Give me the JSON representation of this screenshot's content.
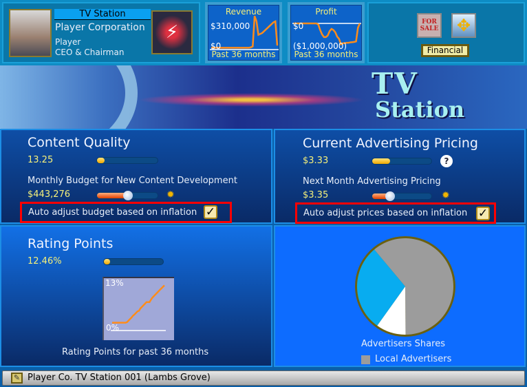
{
  "header": {
    "category": "TV Station",
    "company": "Player Corporation",
    "player": "Player",
    "role": "CEO & Chairman",
    "revenue": {
      "title": "Revenue",
      "top_label": "$310,000",
      "bottom_label": "$0",
      "period": "Past 36 months",
      "values": [
        5,
        5,
        5,
        5,
        5,
        5,
        5,
        5,
        5,
        5,
        5,
        5,
        5,
        5,
        5,
        5,
        5,
        5,
        5,
        5,
        5,
        10,
        20,
        360,
        300,
        150,
        160,
        170,
        190,
        210,
        230,
        250,
        270,
        290,
        300,
        30
      ]
    },
    "profit": {
      "title": "Profit",
      "top_label": "$0",
      "bottom_label": "($1,000,000)",
      "period": "Past 36 months",
      "values": [
        0,
        0,
        0,
        0,
        0,
        0,
        0,
        0,
        0,
        0,
        0,
        0,
        0,
        -50,
        -300,
        -500,
        -620,
        -620,
        -550,
        -350,
        -250,
        -300,
        -400,
        -600,
        -700,
        -950,
        -900,
        -900,
        -880,
        -880,
        -860,
        -850,
        -840,
        -820,
        -200,
        0
      ]
    },
    "for_sale_label": "FOR SALE",
    "financial_button": "Financial"
  },
  "banner": {
    "line1": "TV",
    "line2": "Station"
  },
  "content_quality": {
    "title": "Content Quality",
    "value": "13.25",
    "level": 0.13,
    "budget_label": "Monthly Budget for New Content Development",
    "budget_value": "$443,276",
    "budget_level": 0.5,
    "auto_label": "Auto adjust budget based on inflation",
    "auto_checked": true
  },
  "ad_pricing": {
    "title": "Current Advertising Pricing",
    "value": "$3.33",
    "level": 0.3,
    "help_label": "?",
    "next_label": "Next Month Advertising Pricing",
    "next_value": "$3.35",
    "next_level": 0.3,
    "auto_label": "Auto adjust prices based on inflation",
    "auto_checked": true
  },
  "rating": {
    "title": "Rating Points",
    "value": "12.46%",
    "level": 0.1,
    "top_label": "13%",
    "bottom_label": "0%",
    "caption": "Rating Points for past 36 months",
    "values": [
      0.3,
      0.3,
      0.3,
      0.3,
      0.3,
      0.3,
      0.3,
      0.3,
      0.3,
      0.3,
      0.5,
      1,
      1.5,
      2,
      2.6,
      3,
      3.5,
      4,
      4.2,
      5,
      5.5,
      6,
      6.5,
      7,
      7,
      7,
      7.8,
      8.5,
      9,
      9.5,
      10,
      10.5,
      11,
      11.5,
      12,
      12.46
    ]
  },
  "advertisers": {
    "caption": "Advertisers Shares",
    "legend": [
      {
        "label": "Local Advertisers",
        "color": "#9c9c9c"
      }
    ],
    "slices": [
      {
        "share": 61,
        "color": "#9c9c9c"
      },
      {
        "share": 10,
        "color": "#ffffff"
      },
      {
        "share": 29,
        "color": "#08acf0"
      }
    ]
  },
  "status_bar": {
    "text": "Player Co. TV Station 001 (Lambs Grove)"
  }
}
